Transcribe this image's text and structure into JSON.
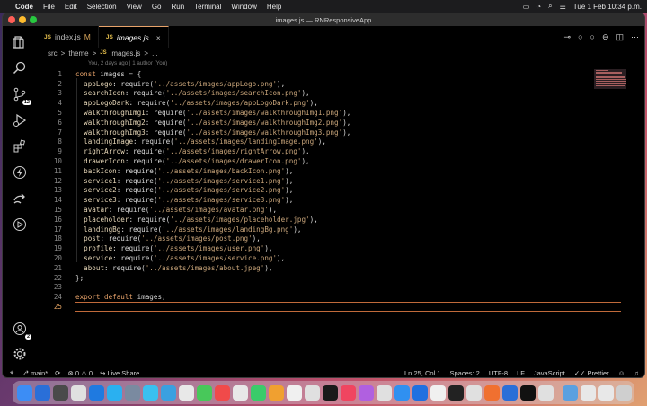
{
  "menubar": {
    "items": [
      "Code",
      "File",
      "Edit",
      "Selection",
      "View",
      "Go",
      "Run",
      "Terminal",
      "Window",
      "Help"
    ],
    "clock": "Tue 1 Feb  10:34 p.m."
  },
  "window": {
    "title": "images.js — RNResponsiveApp"
  },
  "activity_bar": {
    "scm_badge": "12",
    "accounts_badge": "2"
  },
  "tabs": [
    {
      "label": "index.js",
      "badge": "JS",
      "status": "M"
    },
    {
      "label": "images.js",
      "badge": "JS",
      "close": "×"
    }
  ],
  "breadcrumb": [
    "src",
    "theme",
    "images.js",
    "..."
  ],
  "breadcrumb_sep": ">",
  "blame": "You, 2 days ago | 1 author (You)",
  "code_lines": [
    {
      "n": "1",
      "html": "<span class='kw'>const</span> images = {"
    },
    {
      "n": "2",
      "html": "  <span class='prop'>appLogo</span>: require(<span class='str'>'../assets/images/appLogo.png'</span>),"
    },
    {
      "n": "3",
      "html": "  <span class='prop'>searchIcon</span>: require(<span class='str'>'../assets/images/searchIcon.png'</span>),"
    },
    {
      "n": "4",
      "html": "  <span class='prop'>appLogoDark</span>: require(<span class='str'>'../assets/images/appLogoDark.png'</span>),"
    },
    {
      "n": "5",
      "html": "  <span class='prop'>walkthroughImg1</span>: require(<span class='str'>'../assets/images/walkthroughImg1.png'</span>),"
    },
    {
      "n": "6",
      "html": "  <span class='prop'>walkthroughImg2</span>: require(<span class='str'>'../assets/images/walkthroughImg2.png'</span>),"
    },
    {
      "n": "7",
      "html": "  <span class='prop'>walkthroughImg3</span>: require(<span class='str'>'../assets/images/walkthroughImg3.png'</span>),"
    },
    {
      "n": "8",
      "html": "  <span class='prop'>landingImage</span>: require(<span class='str'>'../assets/images/landingImage.png'</span>),"
    },
    {
      "n": "9",
      "html": "  <span class='prop'>rightArrow</span>: require(<span class='str'>'../assets/images/rightArrow.png'</span>),"
    },
    {
      "n": "10",
      "html": "  <span class='prop'>drawerIcon</span>: require(<span class='str'>'../assets/images/drawerIcon.png'</span>),"
    },
    {
      "n": "11",
      "html": "  <span class='prop'>backIcon</span>: require(<span class='str'>'../assets/images/backIcon.png'</span>),"
    },
    {
      "n": "12",
      "html": "  <span class='prop'>service1</span>: require(<span class='str'>'../assets/images/service1.png'</span>),"
    },
    {
      "n": "13",
      "html": "  <span class='prop'>service2</span>: require(<span class='str'>'../assets/images/service2.png'</span>),"
    },
    {
      "n": "14",
      "html": "  <span class='prop'>service3</span>: require(<span class='str'>'../assets/images/service3.png'</span>),"
    },
    {
      "n": "15",
      "html": "  <span class='prop'>avatar</span>: require(<span class='str'>'../assets/images/avatar.png'</span>),"
    },
    {
      "n": "16",
      "html": "  <span class='prop'>placeholder</span>: require(<span class='str'>'../assets/images/placeholder.jpg'</span>),"
    },
    {
      "n": "17",
      "html": "  <span class='prop'>landingBg</span>: require(<span class='str'>'../assets/images/landingBg.png'</span>),"
    },
    {
      "n": "18",
      "html": "  <span class='prop'>post</span>: require(<span class='str'>'../assets/images/post.png'</span>),"
    },
    {
      "n": "19",
      "html": "  <span class='prop'>profile</span>: require(<span class='str'>'../assets/images/user.png'</span>),"
    },
    {
      "n": "20",
      "html": "  <span class='prop'>service</span>: require(<span class='str'>'../assets/images/service.png'</span>),"
    },
    {
      "n": "21",
      "html": "  <span class='prop'>about</span>: require(<span class='str'>'../assets/images/about.jpeg'</span>),"
    },
    {
      "n": "22",
      "html": "};"
    },
    {
      "n": "23",
      "html": ""
    },
    {
      "n": "24",
      "html": "<span class='kw'>export default</span> images;"
    },
    {
      "n": "25",
      "html": "",
      "current": true
    }
  ],
  "statusbar": {
    "branch": "main*",
    "errors": "0",
    "warnings": "0",
    "live_share": "Live Share",
    "position": "Ln 25, Col 1",
    "spaces": "Spaces: 2",
    "encoding": "UTF-8",
    "eol": "LF",
    "language": "JavaScript",
    "prettier": "Prettier"
  },
  "dock": {
    "colors": [
      "#3c8df5",
      "#2a6fd8",
      "#4a4a4a",
      "#e0e0e0",
      "#1f7ae0",
      "#2ab0f0",
      "#7a8aa0",
      "#39c0f0",
      "#3aa0e0",
      "#e8e8e8",
      "#48c85a",
      "#f04a4a",
      "#e8e8e8",
      "#3acb6a",
      "#f0a030",
      "#f0f0f0",
      "#e0e0e0",
      "#1a1a1a",
      "#f04560",
      "#b060e0",
      "#e0e0e0",
      "#3090f0",
      "#2070e0",
      "#f0f0f0",
      "#222",
      "#e0e0e0",
      "#f07030",
      "#2a6fd8",
      "#111",
      "#e0e0e0",
      "#5aa0e0",
      "#e8e8e8",
      "#e8e8e8",
      "#cfcfcf"
    ]
  }
}
